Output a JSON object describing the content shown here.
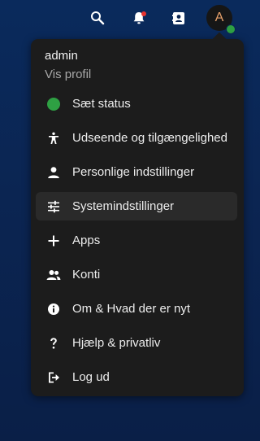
{
  "topbar": {
    "icons": [
      "search-icon",
      "notifications-icon",
      "contacts-icon"
    ],
    "notification_indicator_color": "#e9322e",
    "avatar_letter": "A",
    "avatar_status_color": "#2ea043"
  },
  "menu": {
    "user": {
      "name": "admin",
      "profile_link": "Vis profil"
    },
    "items": [
      {
        "label": "Sæt status",
        "icon": "status-dot-icon"
      },
      {
        "label": "Udseende og tilgængelighed",
        "icon": "accessibility-icon"
      },
      {
        "label": "Personlige indstillinger",
        "icon": "person-icon"
      },
      {
        "label": "Systemindstillinger",
        "icon": "sliders-icon",
        "active": true
      },
      {
        "label": "Apps",
        "icon": "plus-icon"
      },
      {
        "label": "Konti",
        "icon": "accounts-icon"
      },
      {
        "label": "Om & Hvad der er nyt",
        "icon": "info-icon"
      },
      {
        "label": "Hjælp & privatliv",
        "icon": "question-icon"
      },
      {
        "label": "Log ud",
        "icon": "logout-icon"
      }
    ]
  },
  "colors": {
    "status_green": "#2ea043",
    "menu_background": "#1c1c1c",
    "active_item_background": "#2a2a2a"
  }
}
